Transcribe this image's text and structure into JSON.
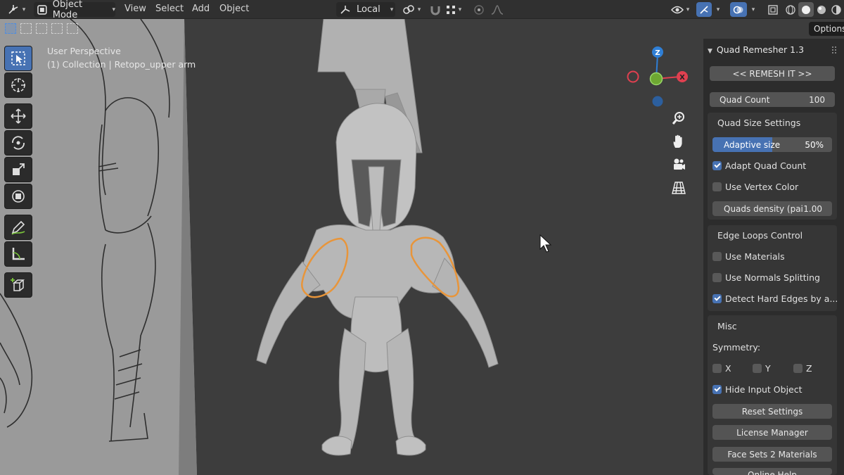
{
  "header": {
    "mode_label": "Object Mode",
    "menus": [
      "View",
      "Select",
      "Add",
      "Object"
    ],
    "orientation_label": "Local"
  },
  "viewport": {
    "perspective_label": "User Perspective",
    "collection_label": "(1) Collection | Retopo_upper arm",
    "gizmo": {
      "z_label": "Z",
      "x_label": "X"
    }
  },
  "options_tab": "Options",
  "addon": {
    "title": "Quad Remesher 1.3",
    "remesh_button": "<< REMESH IT >>",
    "quad_count": {
      "label": "Quad Count",
      "value": "100"
    },
    "quad_size": {
      "title": "Quad Size Settings",
      "adaptive": {
        "label": "Adaptive size",
        "value": "50%",
        "fraction": 0.5
      },
      "adapt_quad_count": {
        "label": "Adapt Quad Count",
        "checked": true
      },
      "use_vertex_color": {
        "label": "Use Vertex Color",
        "checked": false
      },
      "density": {
        "label": "Quads density (pai",
        "value": "1.00"
      }
    },
    "edge_loops": {
      "title": "Edge Loops Control",
      "use_materials": {
        "label": "Use Materials",
        "checked": false
      },
      "use_normals": {
        "label": "Use Normals Splitting",
        "checked": false
      },
      "detect_hard": {
        "label": "Detect Hard Edges by a...",
        "checked": true
      }
    },
    "misc": {
      "title": "Misc",
      "symmetry_label": "Symmetry:",
      "sym_x": "X",
      "sym_y": "Y",
      "sym_z": "Z",
      "hide_input": {
        "label": "Hide Input Object",
        "checked": true
      },
      "reset_button": "Reset Settings",
      "license_button": "License Manager",
      "facesets_button": "Face Sets 2 Materials",
      "online_help_button": "Online Help"
    }
  },
  "colors": {
    "accent": "#4772b3",
    "selection_outline": "#e8953a",
    "axis_x": "#e04050",
    "axis_y": "#7ac43a",
    "axis_z": "#2f7fd6"
  }
}
